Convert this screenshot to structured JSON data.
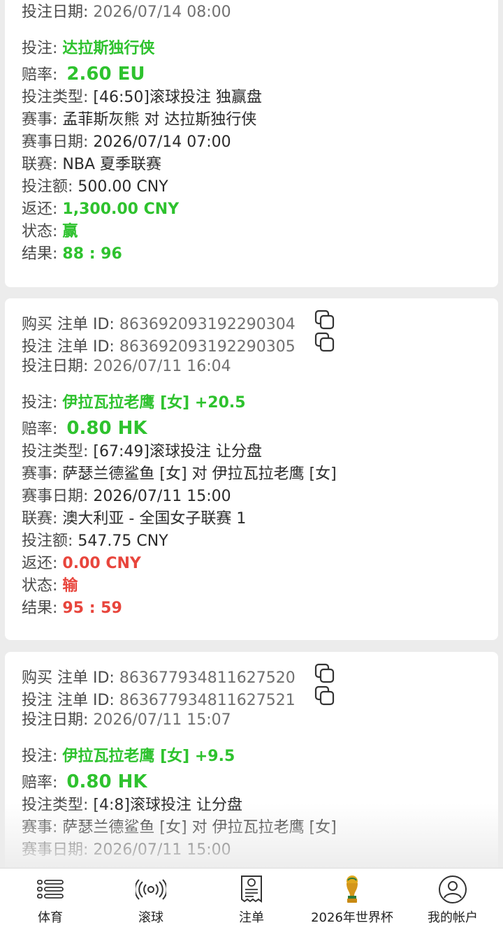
{
  "labels": {
    "buy_id": "购买 注单 ID:",
    "bet_id": "投注 注单 ID:",
    "bet_date": "投注日期:",
    "selection": "投注:",
    "odds": "赔率:",
    "bet_type": "投注类型:",
    "match": "赛事:",
    "match_date": "赛事日期:",
    "league": "联赛:",
    "stake": "投注额:",
    "return": "返还:",
    "status": "状态:",
    "result": "结果:"
  },
  "bets": [
    {
      "bet_date": "2026/07/14 08:00",
      "selection": "达拉斯独行侠",
      "odds": "2.60 EU",
      "bet_type": "[46:50]滚球投注 独赢盘",
      "match": "孟菲斯灰熊 对 达拉斯独行侠",
      "match_date": "2026/07/14 07:00",
      "league": "NBA 夏季联赛",
      "stake": "500.00 CNY",
      "return": "1,300.00 CNY",
      "status": "赢",
      "result": "88 : 96"
    },
    {
      "buy_id": "863692093192290304",
      "bet_id": "863692093192290305",
      "bet_date": "2026/07/11 16:04",
      "selection": "伊拉瓦拉老鹰 [女] +20.5",
      "odds": "0.80 HK",
      "bet_type": "[67:49]滚球投注 让分盘",
      "match": "萨瑟兰德鲨鱼 [女] 对 伊拉瓦拉老鹰 [女]",
      "match_date": "2026/07/11 15:00",
      "league": "澳大利亚 - 全国女子联赛 1",
      "stake": "547.75 CNY",
      "return": "0.00 CNY",
      "status": "输",
      "result": "95 : 59"
    },
    {
      "buy_id": "863677934811627520",
      "bet_id": "863677934811627521",
      "bet_date": "2026/07/11 15:07",
      "selection": "伊拉瓦拉老鹰 [女] +9.5",
      "odds": "0.80 HK",
      "bet_type": "[4:8]滚球投注 让分盘",
      "match": "萨瑟兰德鲨鱼 [女] 对 伊拉瓦拉老鹰 [女]",
      "match_date": "2026/07/11 15:00"
    }
  ],
  "nav": [
    {
      "label": "体育",
      "icon": "list-icon"
    },
    {
      "label": "滚球",
      "icon": "live-broadcast-icon"
    },
    {
      "label": "注单",
      "icon": "bet-slip-icon"
    },
    {
      "label": "2026年世界杯",
      "icon": "world-cup-trophy-icon"
    },
    {
      "label": "我的帐户",
      "icon": "account-icon"
    }
  ],
  "colors": {
    "win": "#2ec22e",
    "loss": "#e8453c",
    "background": "#ececec"
  }
}
